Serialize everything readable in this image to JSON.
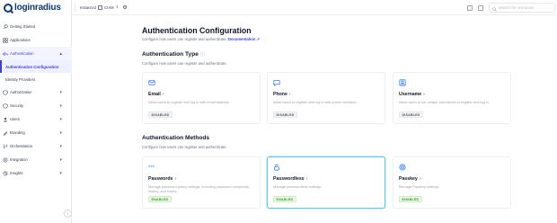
{
  "brand": {
    "logo_text": "loginradius"
  },
  "sidebar": {
    "items": [
      {
        "label": "Getting Started",
        "icon": "rocket-icon",
        "has_chevron": false
      },
      {
        "label": "Applications",
        "icon": "grid-icon",
        "has_chevron": false
      },
      {
        "label": "Authentication",
        "icon": "key-icon",
        "has_chevron": true,
        "open": true
      },
      {
        "label": "Authorization",
        "icon": "check-shield-icon",
        "has_chevron": true
      },
      {
        "label": "Security",
        "icon": "shield-icon",
        "has_chevron": true
      },
      {
        "label": "Users",
        "icon": "user-icon",
        "has_chevron": true
      },
      {
        "label": "Branding",
        "icon": "palette-icon",
        "has_chevron": true
      },
      {
        "label": "Orchestration",
        "icon": "flow-icon",
        "has_chevron": true
      },
      {
        "label": "Integration",
        "icon": "plug-icon",
        "has_chevron": true
      },
      {
        "label": "Insights",
        "icon": "chart-icon",
        "has_chevron": true
      }
    ],
    "sub_items": [
      {
        "label": "Authentication Configuration",
        "active": true
      },
      {
        "label": "Identity Providers",
        "active": false
      }
    ]
  },
  "topbar": {
    "tenant_name": "Instance2",
    "env_label": "CIAM",
    "search_placeholder": "Search for resources"
  },
  "page": {
    "title": "Authentication Configuration",
    "description": "Configure how users can register and authenticate.",
    "doc_link": "Documentation",
    "auth_type": {
      "title": "Authentication Type",
      "description": "Configure how users can register and authenticate."
    },
    "auth_methods": {
      "title": "Authentication Methods",
      "description": "Configure how users can register and authenticate."
    }
  },
  "auth_type_cards": [
    {
      "title": "Email",
      "icon": "mail-icon",
      "description": "Allow users to register and log in with email address.",
      "status": "DISABLED"
    },
    {
      "title": "Phone",
      "icon": "chat-icon",
      "description": "Allow users to register and log in with phone numbers.",
      "status": "DISABLED"
    },
    {
      "title": "Username",
      "icon": "user-card-icon",
      "description": "Allow users to set unique usernames to register and log in.",
      "status": "DISABLED"
    }
  ],
  "auth_method_cards": [
    {
      "title": "Passwords",
      "icon": "password-icon",
      "description": "Manage password policy settings, including password complexity, history, and expiry.",
      "status": "ENABLED"
    },
    {
      "title": "Passwordless",
      "icon": "lock-open-icon",
      "description": "Manage passwordless settings.",
      "status": "ENABLED"
    },
    {
      "title": "Passkey",
      "icon": "fingerprint-icon",
      "description": "Manage Passkey settings.",
      "status": "ENABLED"
    }
  ],
  "colors": {
    "accent": "#3b3fd8",
    "enabled": "#3f9a2b",
    "selected_border": "#60c7e8"
  }
}
